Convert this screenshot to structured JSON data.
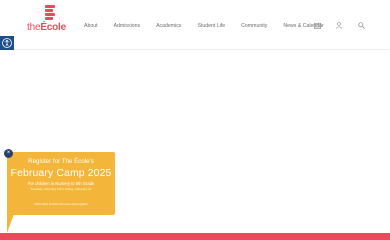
{
  "brand": {
    "logo_prefix": "the",
    "logo_name": "École",
    "color": "#e84c5a"
  },
  "nav": {
    "items": [
      "About",
      "Admissions",
      "Academics",
      "Student Life",
      "Community",
      "News & Calendar"
    ],
    "icons": [
      "flag-icon",
      "user-icon",
      "search-icon"
    ]
  },
  "accessibility": {
    "icon": "accessibility-icon",
    "color": "#1e4d8e"
  },
  "popup": {
    "close_label": "×",
    "line1": "Register for The École's",
    "title": "February Camp 2025",
    "subtitle": "For children in Nursery to 5th Grade",
    "dates": "Tuesday, February 18 to Friday, February 21",
    "link": "Click here to find out more and register",
    "color": "#f4b63a"
  },
  "footer_bar_color": "#e84c5a"
}
